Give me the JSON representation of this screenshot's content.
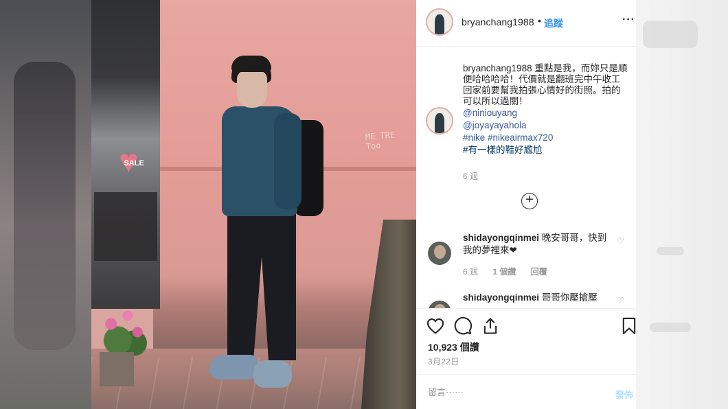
{
  "post": {
    "username": "bryanchang1988",
    "separator": "•",
    "follow_label": "追蹤",
    "more_label": "···"
  },
  "photo": {
    "sale_sign": "SALE",
    "graffiti": "ME TRE Too"
  },
  "caption": {
    "username": "bryanchang1988",
    "text": "重點是我，而妳只是順便哈哈哈哈！代價就是翻班完中午收工回家前要幫我拍張心情好的街照。拍的可以所以過關！",
    "mention1": "@niniouyang",
    "mention2": "@joyayayahola",
    "hashtags": "#nike #nikeairmax720",
    "hashtag_cn": "#有一樣的鞋好尷尬",
    "time": "6 週"
  },
  "comments": [
    {
      "username": "shidayongqinmei",
      "text": "晚安哥哥，快到我的夢裡來❤",
      "time": "6 週",
      "likes": "1 個讚",
      "reply": "回覆"
    },
    {
      "username": "shidayongqinmei",
      "text": "哥哥你壓搶壓"
    }
  ],
  "actions": {
    "likes": "10,923 個讚",
    "date": "3月22日",
    "comment_placeholder": "留言⋯⋯",
    "post_label": "發佈"
  },
  "colors": {
    "link_blue": "#3897f0",
    "tag_blue": "#385898",
    "muted": "#999999",
    "text": "#262626"
  },
  "icons": [
    "heart-icon",
    "comment-icon",
    "share-icon",
    "bookmark-icon",
    "plus-circle-icon",
    "small-heart-icon"
  ]
}
